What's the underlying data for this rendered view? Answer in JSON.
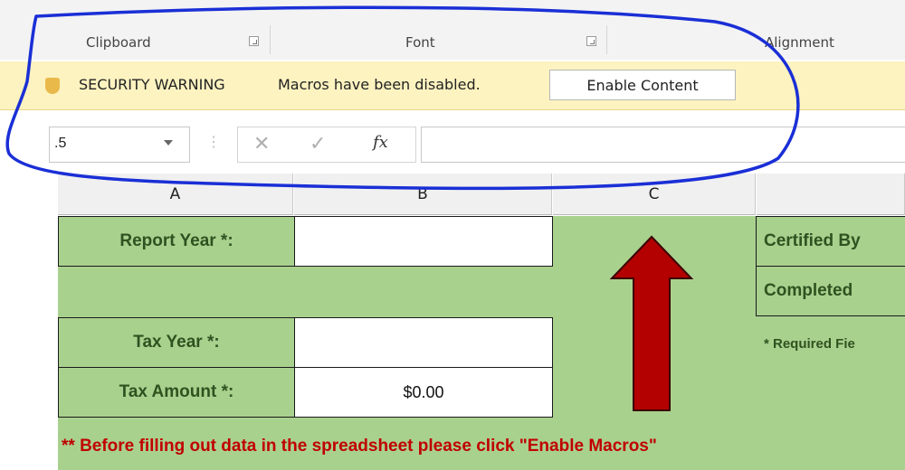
{
  "ribbon": {
    "groups": [
      {
        "label": "Clipboard"
      },
      {
        "label": "Font"
      },
      {
        "label": "Alignment"
      }
    ]
  },
  "security_bar": {
    "title": "SECURITY WARNING",
    "message": "Macros have been disabled.",
    "button_label": "Enable Content"
  },
  "formula_bar": {
    "name_box": ".5",
    "cancel_glyph": "✕",
    "enter_glyph": "✓",
    "insert_function_glyph": "fx",
    "formula": ""
  },
  "columns": [
    "A",
    "B",
    "C"
  ],
  "sheet": {
    "report_year_label": "Report Year *:",
    "report_year_value": "",
    "tax_year_label": "Tax Year *:",
    "tax_year_value": "",
    "tax_amount_label": "Tax Amount *:",
    "tax_amount_value": "$0.00",
    "certified_by_label": "Certified By",
    "completed_label": "Completed",
    "required_note": "* Required Fie",
    "macro_note": "** Before filling out data in the spreadsheet please click \"Enable Macros\""
  },
  "colors": {
    "sheet_green": "#a9d18e",
    "label_text": "#2f5220",
    "warning_bar": "#fdf3c0",
    "note_red": "#c00000",
    "arrow_red": "#b30000",
    "annotation_blue": "#1a2fd6"
  },
  "icons": [
    "shield-icon",
    "dialog-launcher-icon",
    "dropdown-arrow-icon",
    "cancel-icon",
    "enter-icon",
    "insert-function-icon",
    "red-up-arrow-annotation",
    "blue-circle-annotation"
  ]
}
